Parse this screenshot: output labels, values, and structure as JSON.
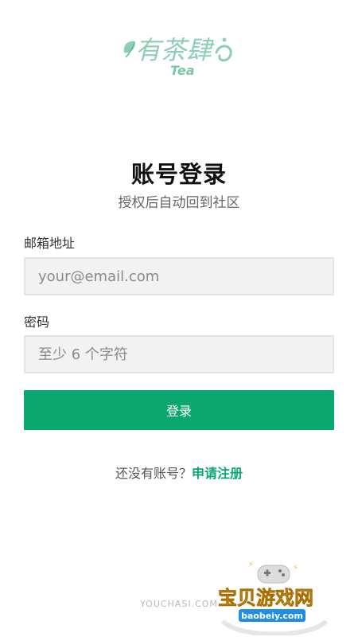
{
  "brand": {
    "logo_text": "有茶肆",
    "logo_sub": "Tea"
  },
  "header": {
    "title": "账号登录",
    "subtitle": "授权后自动回到社区"
  },
  "form": {
    "email_label": "邮箱地址",
    "email_placeholder": "your@email.com",
    "email_value": "",
    "password_label": "密码",
    "password_placeholder": "至少 6 个字符",
    "password_value": "",
    "submit_label": "登录"
  },
  "register": {
    "prompt": "还没有账号？",
    "link_label": "申请注册"
  },
  "footer": {
    "site": "YOUCHASI.COM"
  },
  "watermark": {
    "text": "宝贝游戏网",
    "url": "baobeiy.com"
  },
  "colors": {
    "accent": "#0aa86e",
    "logo_green": "#8ccfb4",
    "input_bg": "#f2f2f2"
  }
}
